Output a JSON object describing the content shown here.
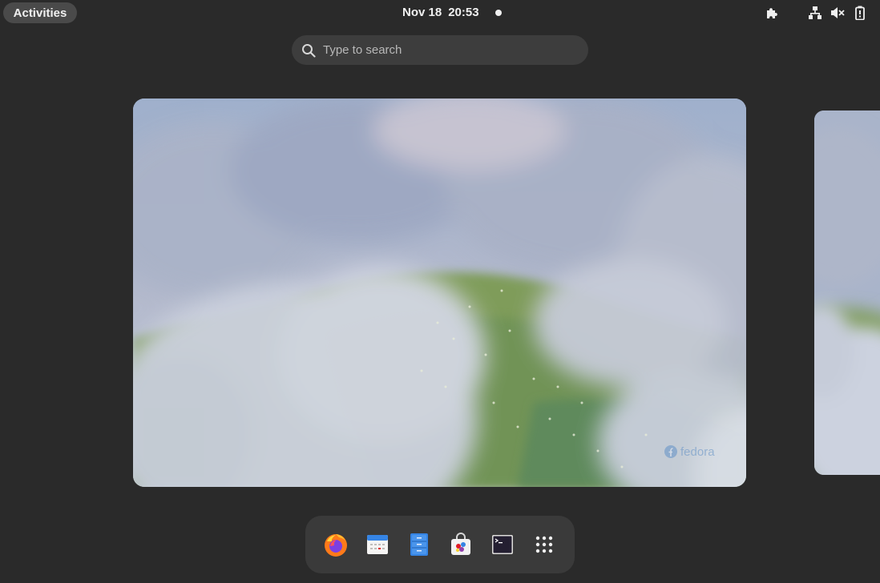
{
  "topbar": {
    "activities_label": "Activities",
    "date": "Nov 18",
    "time": "20:53",
    "tray_icons": [
      "extensions-icon",
      "network-wired-icon",
      "volume-muted-icon",
      "battery-icon"
    ]
  },
  "search": {
    "placeholder": "Type to search"
  },
  "workspaces": {
    "main_wallpaper_logo": "fedora",
    "colors": {
      "sky": "#a6b3cc",
      "cloud": "#d9dde8",
      "hill": "#7f9c5a"
    }
  },
  "dock": {
    "apps": [
      {
        "name": "firefox-icon"
      },
      {
        "name": "calendar-icon"
      },
      {
        "name": "files-icon"
      },
      {
        "name": "software-icon"
      },
      {
        "name": "terminal-icon"
      },
      {
        "name": "show-apps-icon"
      }
    ]
  }
}
